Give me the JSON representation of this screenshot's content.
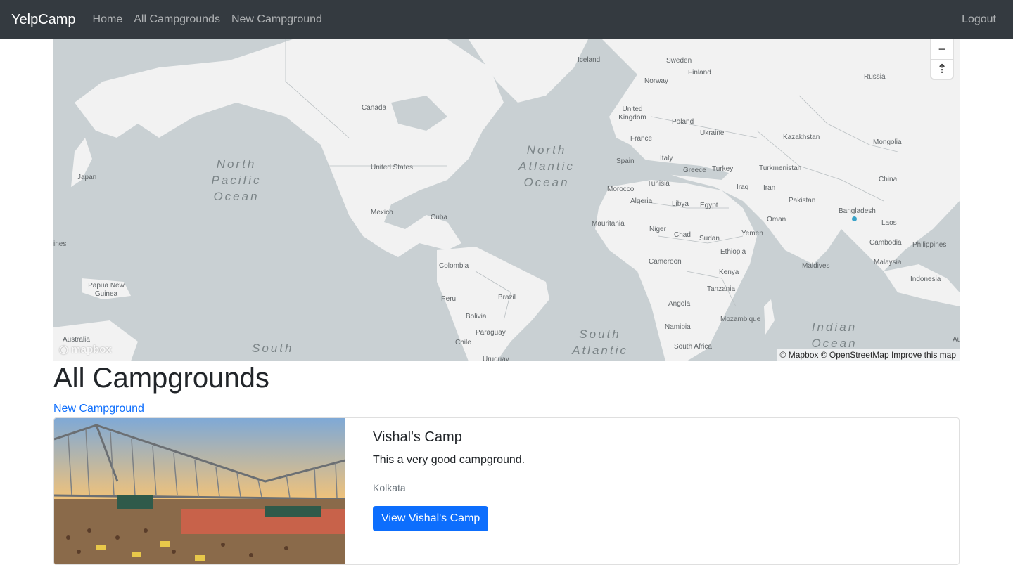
{
  "nav": {
    "brand": "YelpCamp",
    "links": [
      "Home",
      "All Campgrounds",
      "New Campground"
    ],
    "logout": "Logout"
  },
  "map": {
    "countries": [
      "Iceland",
      "Sweden",
      "Finland",
      "Norway",
      "Russia",
      "Canada",
      "United Kingdom",
      "Poland",
      "Ukraine",
      "Kazakhstan",
      "France",
      "Mongolia",
      "Spain",
      "Italy",
      "United States",
      "Greece",
      "Turkey",
      "Turkmenistan",
      "Japan",
      "Iraq",
      "Iran",
      "China",
      "Morocco",
      "Tunisia",
      "Algeria",
      "Libya",
      "Egypt",
      "Pakistan",
      "Bangladesh",
      "Mexico",
      "Cuba",
      "Oman",
      "Laos",
      "Mauritania",
      "Niger",
      "Chad",
      "Sudan",
      "Yemen",
      "Cambodia",
      "Philippines",
      "Ethiopia",
      "Colombia",
      "Cameroon",
      "Kenya",
      "Maldives",
      "Malaysia",
      "Papua New Guinea",
      "Brazil",
      "Tanzania",
      "Indonesia",
      "Peru",
      "Bolivia",
      "Angola",
      "Mozambique",
      "Paraguay",
      "Namibia",
      "Chile",
      "Australia",
      "South Africa",
      "Uruguay"
    ],
    "oceans": [
      "North Pacific Ocean",
      "North Atlantic Ocean",
      "South Atlantic",
      "Indian Ocean",
      "South"
    ],
    "edge_label_left": "ines",
    "edge_label_right": "Au",
    "zoom_out": "−",
    "compass": "⇡",
    "logo": "mapbox",
    "attribution": "© Mapbox © OpenStreetMap Improve this map",
    "marker_color": "#3aa3c9"
  },
  "page": {
    "title": "All Campgrounds",
    "new_link": "New Campground"
  },
  "campgrounds": [
    {
      "title": "Vishal's Camp",
      "description": "This a very good campground.",
      "location": "Kolkata",
      "button": "View Vishal's Camp"
    }
  ],
  "colors": {
    "navbar": "#343a40",
    "primary": "#0d6efd",
    "map_water": "#c9d0d3",
    "map_land": "#f2f2f2"
  }
}
